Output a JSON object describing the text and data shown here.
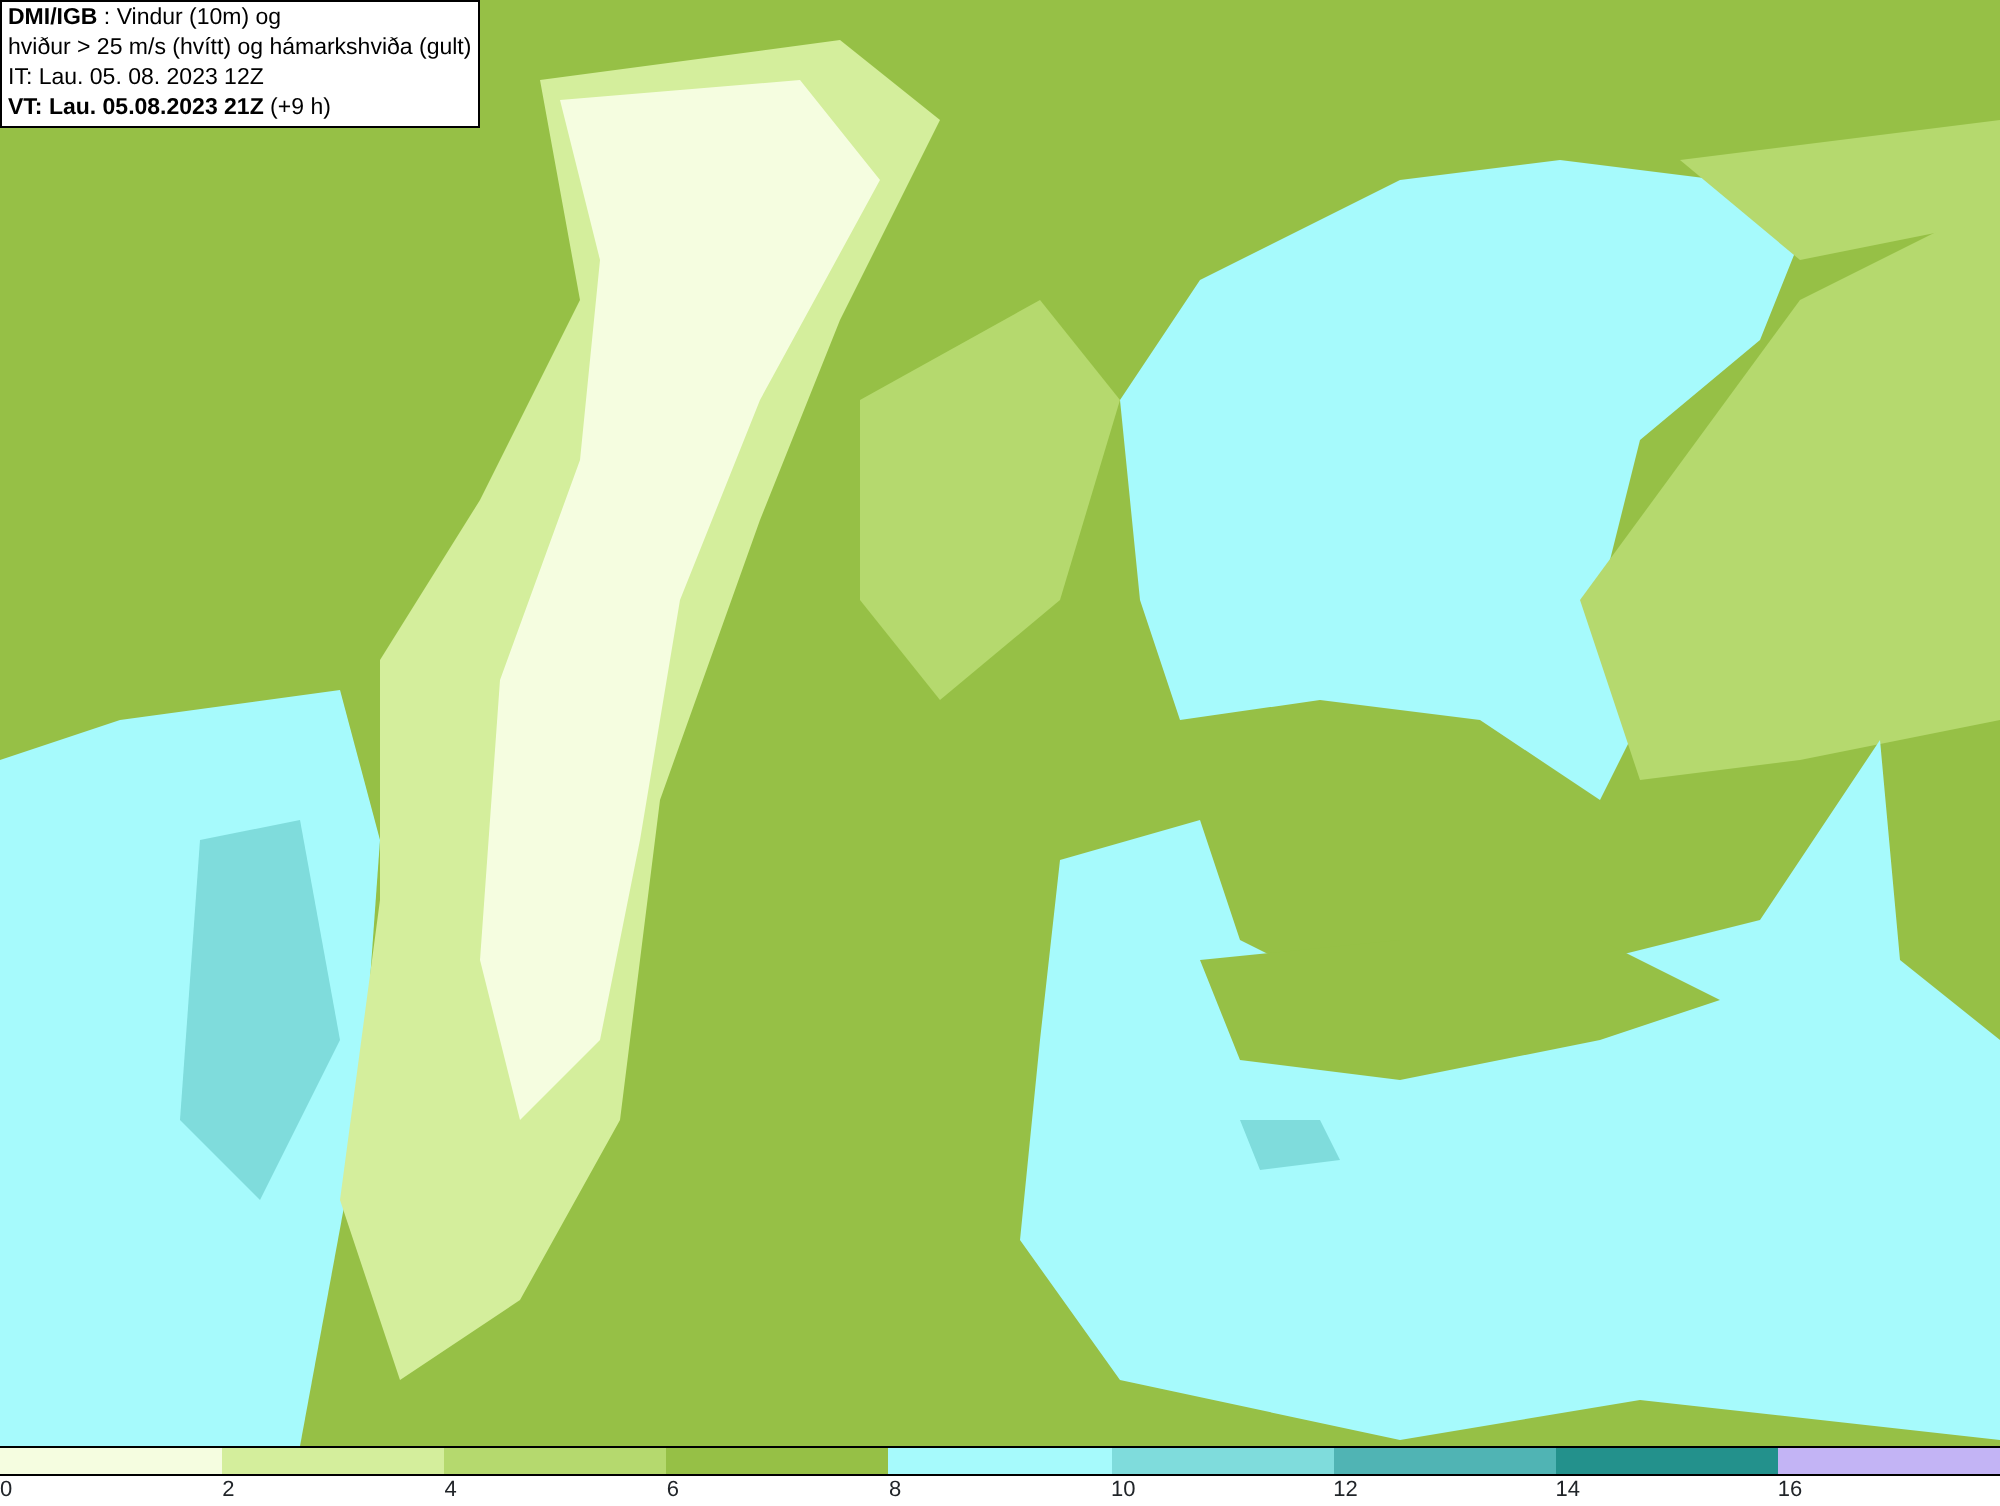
{
  "info_box": {
    "lines": [
      "**DMI/IGB** : Vindur (10m) og",
      "hviður > 25 m/s (hvítt) og hámarkshviða (gult)",
      "IT: Lau. 05. 08. 2023 12Z",
      "**VT: Lau. 05.08.2023 21Z** (+9 h)"
    ]
  },
  "legend": {
    "segments": [
      {
        "label": "0",
        "color": "#f5fde0"
      },
      {
        "label": "2",
        "color": "#d4ee9c"
      },
      {
        "label": "4",
        "color": "#b5d96e"
      },
      {
        "label": "6",
        "color": "#96c046"
      },
      {
        "label": "8",
        "color": "#a6fafc"
      },
      {
        "label": "10",
        "color": "#7fdcdc"
      },
      {
        "label": "12",
        "color": "#50b4b4"
      },
      {
        "label": "14",
        "color": "#23918c"
      },
      {
        "label": "16",
        "color": "#c3b4f5"
      }
    ]
  }
}
